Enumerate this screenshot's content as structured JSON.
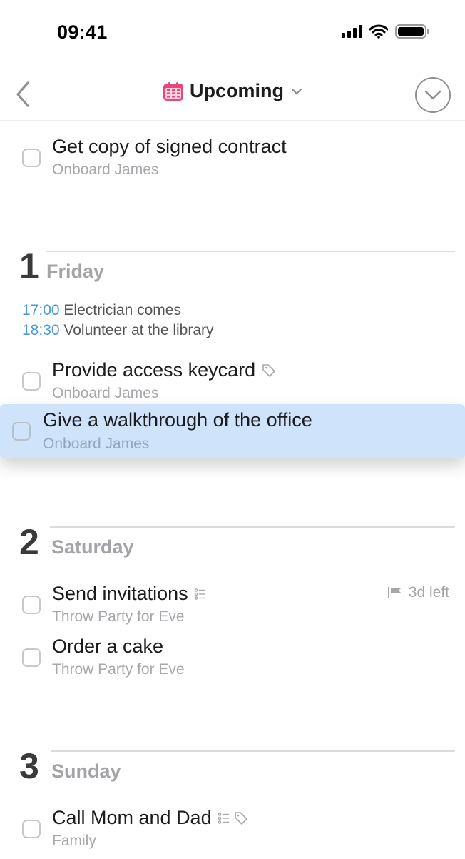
{
  "status_bar": {
    "time": "09:41",
    "icons": [
      "cellular-signal-icon",
      "wifi-icon",
      "battery-icon"
    ]
  },
  "nav": {
    "back_icon": "chevron-left-icon",
    "title_icon": "calendar-icon",
    "title": "Upcoming",
    "title_dropdown_icon": "chevron-down-icon",
    "right_action_icon": "circle-chevron-down-icon",
    "accent_color": "#e8467c"
  },
  "top_task": {
    "title": "Get copy of signed contract",
    "project": "Onboard James"
  },
  "days": [
    {
      "number": "1",
      "name": "Friday",
      "events": [
        {
          "time": "17:00",
          "title": "Electrician comes"
        },
        {
          "time": "18:30",
          "title": "Volunteer at the library"
        }
      ],
      "tasks": [
        {
          "title": "Provide access keycard",
          "project": "Onboard James",
          "icons": [
            "tag-icon"
          ]
        },
        {
          "title": "Give a walkthrough of the office",
          "project": "Onboard James",
          "state": "dragging"
        }
      ]
    },
    {
      "number": "2",
      "name": "Saturday",
      "tasks": [
        {
          "title": "Send invitations",
          "project": "Throw Party for Eve",
          "icons": [
            "checklist-icon"
          ],
          "deadline": "3d left",
          "deadline_icon": "flag-icon"
        },
        {
          "title": "Order a cake",
          "project": "Throw Party for Eve"
        }
      ]
    },
    {
      "number": "3",
      "name": "Sunday",
      "tasks": [
        {
          "title": "Call Mom and Dad",
          "project": "Family",
          "icons": [
            "checklist-icon",
            "tag-icon"
          ]
        }
      ]
    }
  ],
  "colors": {
    "event_time": "#4a9ad8",
    "drag_highlight": "#cfe4fb",
    "secondary_text": "#a7a7ac"
  }
}
